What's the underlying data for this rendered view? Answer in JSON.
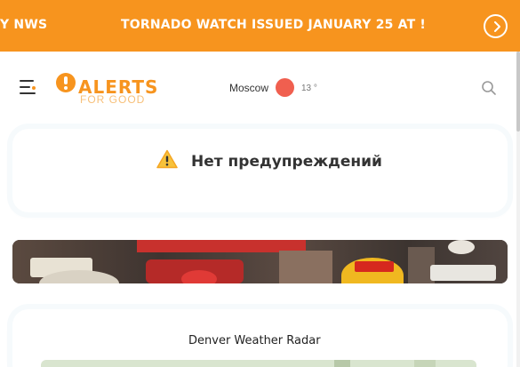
{
  "ticker": {
    "text_left": "Y NWS",
    "text_main": "TORNADO WATCH ISSUED JANUARY 25 AT !",
    "next_icon": "chevron-right-circle-icon"
  },
  "header": {
    "menu_icon": "hamburger-menu-icon",
    "logo": {
      "word": "ALERTS",
      "subword": "FOR GOOD"
    },
    "city": "Moscow",
    "temperature": "13 °",
    "search_icon": "search-icon"
  },
  "alert": {
    "icon": "warning-icon",
    "text": "Нет предупреждений"
  },
  "radar": {
    "title": "Denver Weather Radar"
  },
  "colors": {
    "accent": "#f7941e",
    "weather_dot": "#f05f4f",
    "text": "#333333"
  }
}
